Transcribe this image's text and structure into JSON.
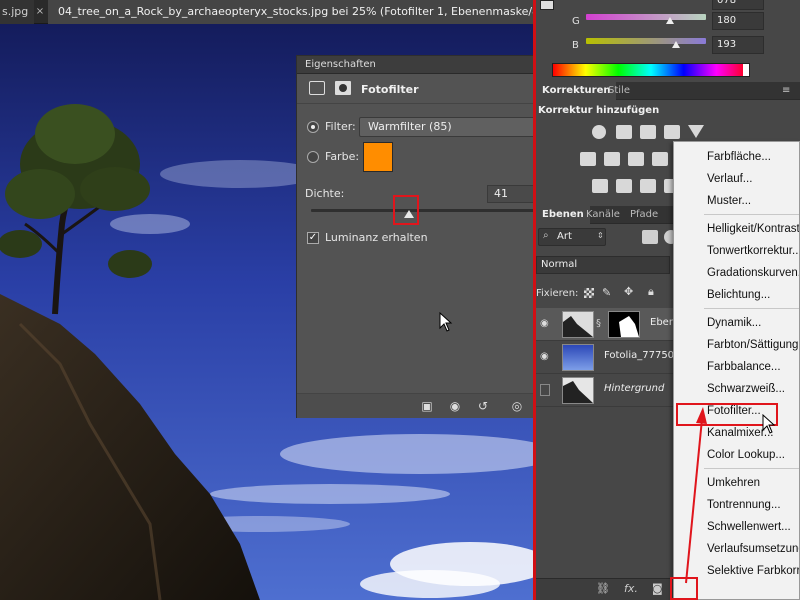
{
  "document_tabs": {
    "tab1_label": "s.jpg",
    "tab1_close": "×",
    "tab2_label": "04_tree_on_a_Rock_by_archaeopteryx_stocks.jpg bei 25% (Fotofilter 1, Ebenenmaske/8) *",
    "tab2_close": "×"
  },
  "properties_panel": {
    "title": "Eigenschaften",
    "heading": "Fotofilter",
    "filter_label": "Filter:",
    "filter_value": "Warmfilter (85)",
    "filter_selected": true,
    "color_label": "Farbe:",
    "color_value": "#ff8d00",
    "density_label": "Dichte:",
    "density_value": "41",
    "density_percent": 41,
    "luminance_label": "Luminanz erhalten",
    "luminance_checked": true
  },
  "color_panel": {
    "g_label": "G",
    "g_value": "180",
    "b_label": "B",
    "b_value": "193",
    "top_value": "078"
  },
  "adjustments_panel": {
    "tabs": [
      "Korrekturen",
      "Stile"
    ],
    "active_tab": "Korrekturen",
    "add_label": "Korrektur hinzufügen"
  },
  "layers_panel": {
    "tabs": [
      "Ebenen",
      "Kanäle",
      "Pfade"
    ],
    "active_tab": "Ebenen",
    "kind_filter": "Art",
    "blend_mode": "Normal",
    "lock_label": "Fixieren:",
    "layers": [
      {
        "name": "Eben",
        "italic": false
      },
      {
        "name": "Fotolia_7775064",
        "italic": false
      },
      {
        "name": "Hintergrund",
        "italic": true
      }
    ],
    "footer_icons": [
      "link-icon",
      "fx-icon",
      "mask-icon",
      "adjustment-icon",
      "folder-icon",
      "new-layer-icon",
      "trash-icon"
    ]
  },
  "adjustment_menu": {
    "items": [
      "Farbfläche...",
      "Verlauf...",
      "Muster...",
      "Helligkeit/Kontrast...",
      "Tonwertkorrektur...",
      "Gradationskurven...",
      "Belichtung...",
      "Dynamik...",
      "Farbton/Sättigung...",
      "Farbbalance...",
      "Schwarzweiß...",
      "Fotofilter...",
      "Kanalmixer...",
      "Color Lookup...",
      "Umkehren",
      "Tontrennung...",
      "Schwellenwert...",
      "Verlaufsumsetzung...",
      "Selektive Farbkorrektur..."
    ],
    "highlighted": "Fotofilter..."
  },
  "colors": {
    "accent_red": "#e0151c",
    "swatch_orange": "#ff8d00",
    "panel_bg": "#535353"
  }
}
